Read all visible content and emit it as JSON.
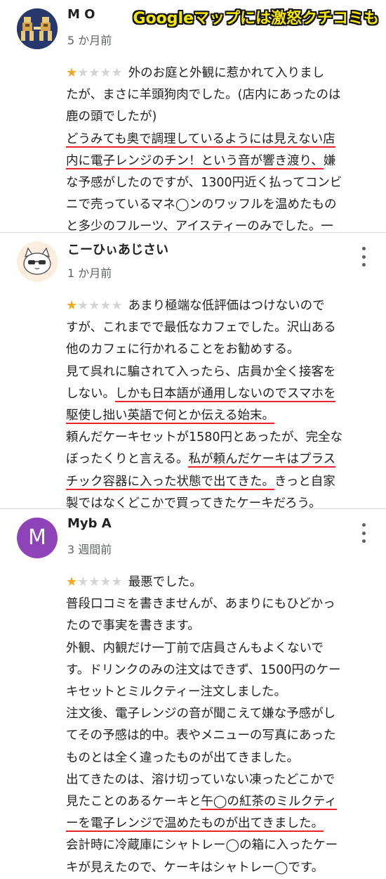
{
  "banner": "Googleマップには激怒クチコミも",
  "colors": {
    "star_on": "#f3a91c",
    "star_off": "#d4d4d4",
    "underline": "#e8242c",
    "avatar_m": "#8e44b8"
  },
  "reviews": [
    {
      "author": "M O",
      "date": "5 か月前",
      "rating": 1,
      "avatar": "pixel-art-avatar",
      "lines": [
        {
          "pre": "外のお庭と外観に惹かれて入りまし",
          "ul": "",
          "post": ""
        },
        {
          "pre": "たが、まさに羊頭狗肉でした。(店内にあったのは",
          "ul": "",
          "post": ""
        },
        {
          "pre": "鹿の頭でしたが)",
          "ul": "",
          "post": ""
        },
        {
          "pre": "",
          "ul": "どうみても奥で調理しているようには見えない店",
          "post": ""
        },
        {
          "pre": "",
          "ul": "内に電子レンジのチン！という音が響き渡り、",
          "post": "嫌"
        },
        {
          "pre": "な予感がしたのですが、1300円近く払ってコンビ",
          "ul": "",
          "post": ""
        },
        {
          "pre": "ニで売っているマネ◯ンのワッフルを温めたもの",
          "ul": "",
          "post": ""
        },
        {
          "pre": "と多少のフルーツ、アイスティーのみでした。一",
          "ul": "",
          "post": ""
        }
      ]
    },
    {
      "author": "こーひぃあじさい",
      "date": "1 か月前",
      "rating": 1,
      "avatar": "cat-avatar",
      "lines": [
        {
          "pre": "あまり極端な低評価はつけないので",
          "ul": "",
          "post": ""
        },
        {
          "pre": "すが、これまでで最低なカフェでした。沢山ある",
          "ul": "",
          "post": ""
        },
        {
          "pre": "他のカフェに行かれることをお勧めする。",
          "ul": "",
          "post": ""
        },
        {
          "pre": "見て呉れに騙されて入ったら、店員か全く接客を",
          "ul": "",
          "post": ""
        },
        {
          "pre": "しない。",
          "ul": "しかも日本語が通用しないのでスマホを",
          "post": ""
        },
        {
          "pre": "",
          "ul": "駆使し拙い英語で何とか伝える始末。",
          "post": ""
        },
        {
          "pre": "頼んだケーキセットが1580円とあったが、完全な",
          "ul": "",
          "post": ""
        },
        {
          "pre": "ぼったくりと言える。",
          "ul": "私が頼んだケーキはプラス",
          "post": ""
        },
        {
          "pre": "",
          "ul": "チック容器に入った状態で出てきた。",
          "post": "きっと自家"
        },
        {
          "pre": "製ではなくどこかで買ってきたケーキだろう。",
          "ul": "",
          "post": ""
        }
      ]
    },
    {
      "author": "Myb A",
      "date": "3 週間前",
      "rating": 1,
      "avatar_letter": "M",
      "lines": [
        {
          "pre": "最悪でした。",
          "ul": "",
          "post": ""
        },
        {
          "pre": "普段口コミを書きませんが、あまりにもひどかっ",
          "ul": "",
          "post": ""
        },
        {
          "pre": "たので事実を書きます。",
          "ul": "",
          "post": ""
        },
        {
          "pre": "外観、内観だけ一丁前で店員さんもよくないで",
          "ul": "",
          "post": ""
        },
        {
          "pre": "す。ドリンクのみの注文はできず、1500円のケー",
          "ul": "",
          "post": ""
        },
        {
          "pre": "キセットとミルクティー注文しました。",
          "ul": "",
          "post": ""
        },
        {
          "pre": "注文後、電子レンジの音が聞こえて嫌な予感がし",
          "ul": "",
          "post": ""
        },
        {
          "pre": "てその予感は的中。表やメニューの写真にあった",
          "ul": "",
          "post": ""
        },
        {
          "pre": "ものとは全く違ったものが出てきました。",
          "ul": "",
          "post": ""
        },
        {
          "pre": "出てきたのは、溶け切っていない凍ったどこかで",
          "ul": "",
          "post": ""
        },
        {
          "pre": "見たことのあるケーキと",
          "ul": "午◯の紅茶のミルクティ",
          "post": ""
        },
        {
          "pre": "",
          "ul": "ーを電子レンジで温めたものが出てきました。",
          "post": ""
        },
        {
          "pre": "会計時に冷蔵庫にシャトレー◯の箱に入ったケー",
          "ul": "",
          "post": ""
        },
        {
          "pre": "キが見えたので、ケーキはシャトレー◯です。",
          "ul": "",
          "post": ""
        }
      ]
    }
  ]
}
